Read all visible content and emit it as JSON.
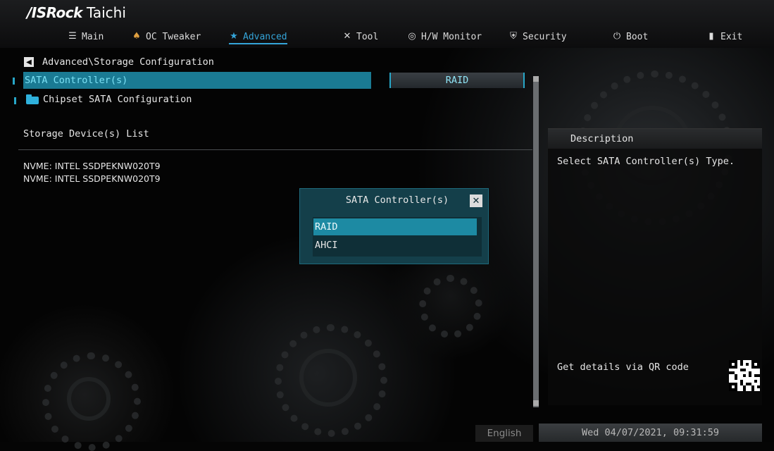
{
  "header": {
    "brand": "/ISRock",
    "model": "Taichi"
  },
  "nav": {
    "tabs": [
      {
        "label": "Main",
        "icon": "list-icon"
      },
      {
        "label": "OC Tweaker",
        "icon": "rocket-icon"
      },
      {
        "label": "Advanced",
        "icon": "star-icon",
        "active": true
      },
      {
        "label": "Tool",
        "icon": "tools-icon"
      },
      {
        "label": "H/W Monitor",
        "icon": "monitor-icon"
      },
      {
        "label": "Security",
        "icon": "shield-icon"
      },
      {
        "label": "Boot",
        "icon": "power-icon"
      },
      {
        "label": "Exit",
        "icon": "exit-icon"
      }
    ]
  },
  "breadcrumb": "Advanced\\Storage Configuration",
  "settings": {
    "sata_controller_label": "SATA Controller(s)",
    "sata_controller_value": "RAID",
    "chipset_sata_label": "Chipset SATA Configuration"
  },
  "storage": {
    "title": "Storage Device(s) List",
    "devices": [
      "NVME: INTEL SSDPEKNW020T9",
      "NVME: INTEL SSDPEKNW020T9"
    ]
  },
  "popup": {
    "title": "SATA Controller(s)",
    "options": [
      "RAID",
      "AHCI"
    ],
    "selected": "RAID"
  },
  "description": {
    "heading": "Description",
    "text": "Select SATA Controller(s) Type.",
    "qr_text": "Get details via QR code"
  },
  "footer": {
    "language": "English",
    "datetime": "Wed 04/07/2021, 09:31:59"
  },
  "colors": {
    "accent": "#27a7c8",
    "selected_row": "#1a7a93",
    "popup_bg": "#143f4a"
  }
}
